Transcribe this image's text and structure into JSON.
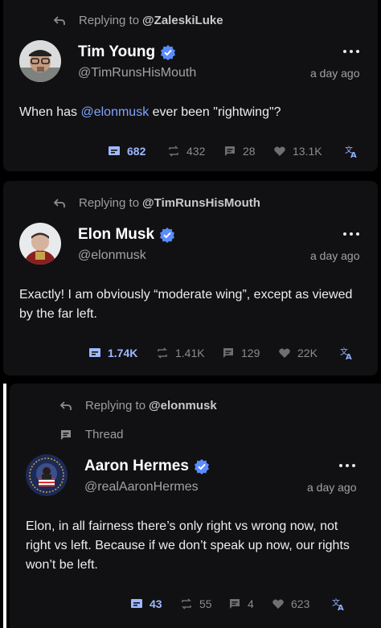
{
  "colors": {
    "accent": "#7fa3ff",
    "verified": "#1d9bf0",
    "card_bg": "#111113",
    "muted": "#8b8b90"
  },
  "tweets": [
    {
      "replying_prefix": "Replying to",
      "replying_to": "@ZaleskiLuke",
      "name": "Tim Young",
      "handle": "@TimRunsHisMouth",
      "time": "a day ago",
      "text_before": "When has ",
      "text_mention": "@elonmusk",
      "text_after": " ever been \"rightwing\"?",
      "views": "682",
      "retweets": "432",
      "replies": "28",
      "likes": "13.1K"
    },
    {
      "replying_prefix": "Replying to",
      "replying_to": "@TimRunsHisMouth",
      "name": "Elon Musk",
      "handle": "@elonmusk",
      "time": "a day ago",
      "text": "Exactly! I am obviously “moderate wing”, except as viewed by the far left.",
      "views": "1.74K",
      "retweets": "1.41K",
      "replies": "129",
      "likes": "22K"
    },
    {
      "replying_prefix": "Replying to",
      "replying_to": "@elonmusk",
      "thread_label": "Thread",
      "name": "Aaron Hermes",
      "handle": "@realAaronHermes",
      "time": "a day ago",
      "text": "Elon, in all fairness there’s only right vs wrong now, not right vs left. Because if we don’t speak up now, our rights won’t be left.",
      "views": "43",
      "retweets": "55",
      "replies": "4",
      "likes": "623"
    }
  ]
}
